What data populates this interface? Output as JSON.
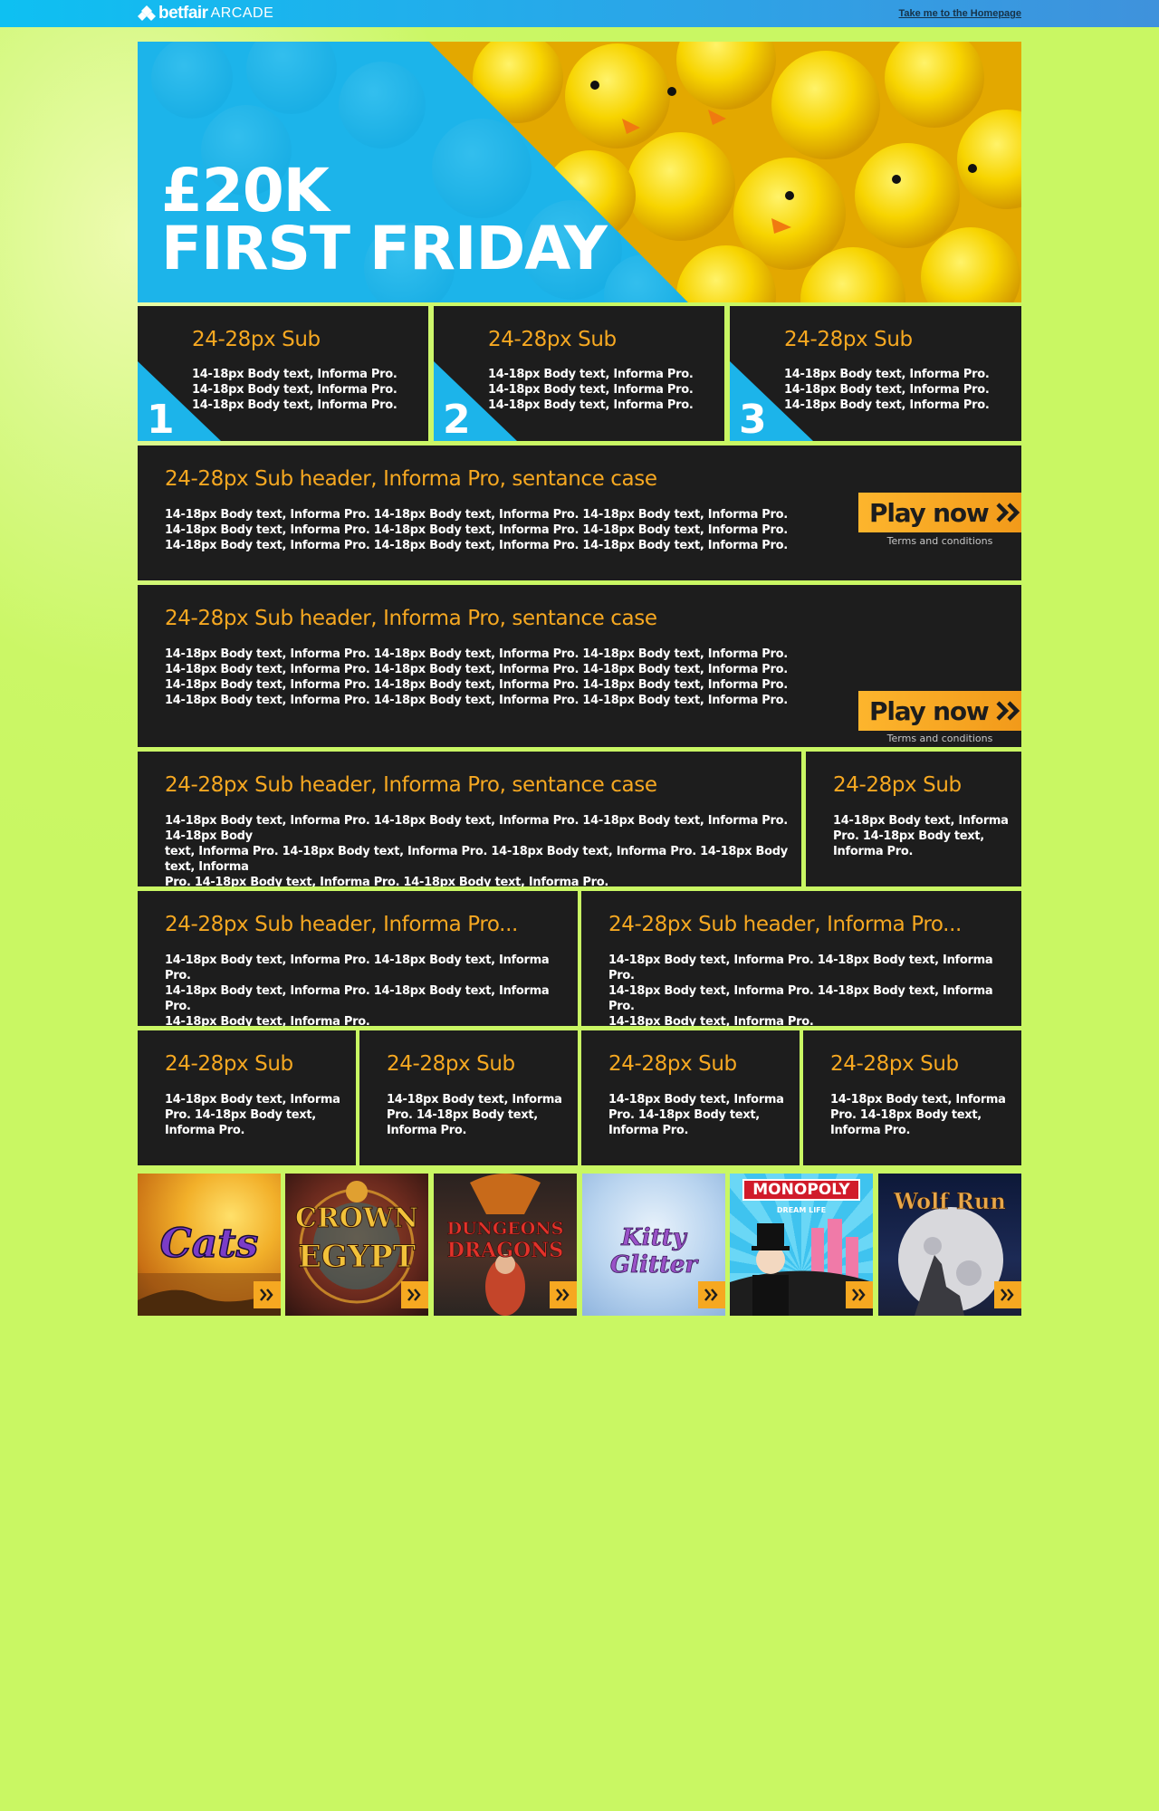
{
  "header": {
    "brand": "betfair",
    "brand_suffix": "ARCADE",
    "home_link": "Take me to the Homepage"
  },
  "hero": {
    "line1": "£20K",
    "line2": "FIRST FRIDAY"
  },
  "steps": [
    {
      "number": "1",
      "title": "24-28px Sub",
      "body": [
        "14-18px Body text, Informa Pro.",
        "14-18px Body text, Informa Pro.",
        "14-18px Body text, Informa Pro."
      ]
    },
    {
      "number": "2",
      "title": "24-28px Sub",
      "body": [
        "14-18px Body text, Informa Pro.",
        "14-18px Body text, Informa Pro.",
        "14-18px Body text, Informa Pro."
      ]
    },
    {
      "number": "3",
      "title": "24-28px Sub",
      "body": [
        "14-18px Body text, Informa Pro.",
        "14-18px Body text, Informa Pro.",
        "14-18px Body text, Informa Pro."
      ]
    }
  ],
  "promo1": {
    "title": "24-28px Sub header, Informa Pro, sentance case",
    "body": [
      "14-18px Body text, Informa Pro. 14-18px Body text, Informa Pro. 14-18px Body text, Informa Pro.",
      "14-18px Body text, Informa Pro. 14-18px Body text, Informa Pro. 14-18px Body text, Informa Pro.",
      "14-18px Body text, Informa Pro. 14-18px Body text, Informa Pro. 14-18px Body text, Informa Pro."
    ],
    "cta": "Play now",
    "terms": "Terms and conditions"
  },
  "promo2": {
    "title": "24-28px Sub header, Informa Pro, sentance case",
    "body": [
      "14-18px Body text, Informa Pro. 14-18px Body text, Informa Pro. 14-18px Body text, Informa Pro.",
      "14-18px Body text, Informa Pro. 14-18px Body text, Informa Pro. 14-18px Body text, Informa Pro.",
      "14-18px Body text, Informa Pro. 14-18px Body text, Informa Pro. 14-18px Body text, Informa Pro.",
      "14-18px Body text, Informa Pro. 14-18px Body text, Informa Pro. 14-18px Body text, Informa Pro."
    ],
    "cta": "Play now",
    "terms": "Terms and conditions"
  },
  "wide_row": {
    "left": {
      "title": "24-28px Sub header, Informa Pro, sentance case",
      "body": [
        "14-18px Body text, Informa Pro. 14-18px Body text, Informa Pro. 14-18px Body text, Informa Pro. 14-18px Body",
        "text, Informa Pro. 14-18px Body text, Informa Pro. 14-18px Body text, Informa Pro. 14-18px Body text, Informa",
        "Pro. 14-18px Body text, Informa Pro. 14-18px Body text, Informa Pro."
      ]
    },
    "right": {
      "title": "24-28px Sub",
      "body": [
        "14-18px Body text, Informa",
        "Pro. 14-18px Body text,",
        "Informa Pro."
      ]
    }
  },
  "half_row": [
    {
      "title": "24-28px Sub header, Informa Pro...",
      "body": [
        "14-18px Body text, Informa Pro. 14-18px Body text, Informa Pro.",
        "14-18px Body text, Informa Pro. 14-18px Body text, Informa Pro.",
        "14-18px Body text, Informa Pro."
      ]
    },
    {
      "title": "24-28px Sub header, Informa Pro...",
      "body": [
        "14-18px Body text, Informa Pro. 14-18px Body text, Informa Pro.",
        "14-18px Body text, Informa Pro. 14-18px Body text, Informa Pro.",
        "14-18px Body text, Informa Pro."
      ]
    }
  ],
  "quarter_row": [
    {
      "title": "24-28px Sub",
      "body": [
        "14-18px Body text, Informa",
        "Pro. 14-18px Body text,",
        "Informa Pro."
      ]
    },
    {
      "title": "24-28px Sub",
      "body": [
        "14-18px Body text, Informa",
        "Pro. 14-18px Body text,",
        "Informa Pro."
      ]
    },
    {
      "title": "24-28px Sub",
      "body": [
        "14-18px Body text, Informa",
        "Pro. 14-18px Body text,",
        "Informa Pro."
      ]
    },
    {
      "title": "24-28px Sub",
      "body": [
        "14-18px Body text, Informa",
        "Pro. 14-18px Body text,",
        "Informa Pro."
      ]
    }
  ],
  "games": [
    {
      "name": "Cats",
      "bg": "#e8a31d"
    },
    {
      "name": "CROWN OF EGYPT",
      "line1": "CROWN",
      "line2": "EGYPT",
      "bg": "#6b2a1e"
    },
    {
      "name": "DUNGEONS & DRAGONS",
      "line1": "DUNGEONS",
      "line2": "DRAGONS",
      "bg": "#3a2c26"
    },
    {
      "name": "Kitty Glitter",
      "bg": "#b9d4ef"
    },
    {
      "name": "MONOPOLY",
      "sub": "DREAM LIFE",
      "bg": "#3fc3ef"
    },
    {
      "name": "Wolf Run",
      "bg": "#1c2a55"
    }
  ],
  "colors": {
    "background": "#c9f763",
    "panel": "#1d1d1d",
    "accent": "#f6a821",
    "blue": "#1cb4ea"
  }
}
